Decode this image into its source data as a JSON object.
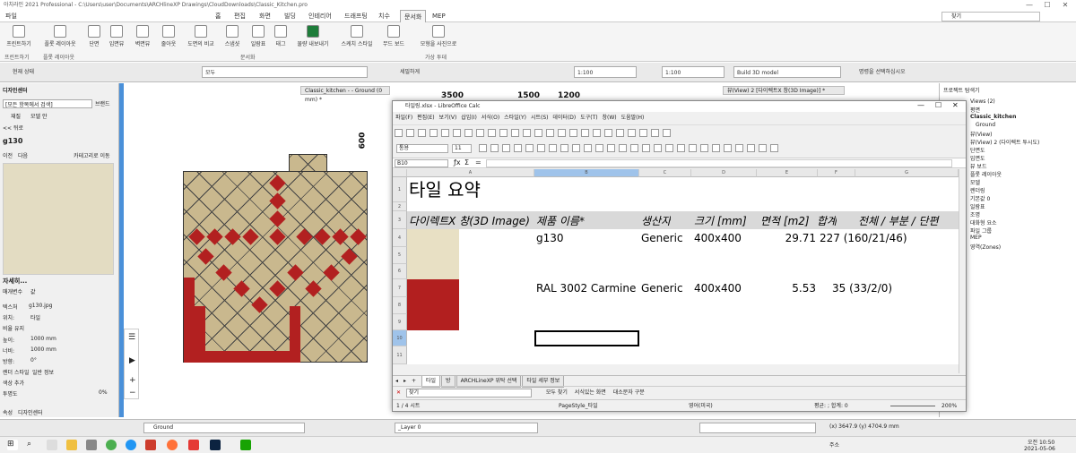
{
  "app": {
    "title": "아치라인 2021  Professional - C:\\Users\\user\\Documents\\ARCHlineXP Drawings\\CloudDownloads\\Classic_Kitchen.pro",
    "minimize": "—",
    "maximize": "☐",
    "close": "✕"
  },
  "menubar": {
    "tabs": [
      "파일",
      "홈",
      "편집",
      "화면",
      "빌딩",
      "인테리어",
      "드래프팅",
      "치수",
      "문서화",
      "MEP"
    ],
    "active_index": 8,
    "search_placeholder": "찾기"
  },
  "ribbon": {
    "buttons": [
      "프린트하기",
      "플롯 레이아웃",
      "단면",
      "입면뷰",
      "벽면뷰",
      "줄아웃",
      "도면의 비교",
      "스냅샷",
      "일람표",
      "태그",
      "물량 내보내기",
      "스케치 스타일",
      "무드 보드",
      "모형을 사진으로"
    ],
    "groups": [
      "프린트하기",
      "플롯 레이아웃",
      "문서화",
      "가상 투데"
    ]
  },
  "propbar": {
    "state": "현재 상태",
    "filter": "모두",
    "scale_label": "세밀하게",
    "scale1": "1:100",
    "scale2": "1:100",
    "model": "Build 3D model",
    "hint": "명령을 선택하십시오"
  },
  "designcenter": {
    "title": "디자인센터",
    "search_placeholder": "[모든 항목에서 검색]",
    "browse": "브랜드",
    "tabs": [
      "재질",
      "모델 안"
    ],
    "back": "<< 뒤로",
    "item": "g130",
    "subtabs": [
      "이전",
      "다음",
      "카테고리로 이동"
    ],
    "details_title": "자세히...",
    "param_col": "매개변수",
    "value_col": "값",
    "texture_label": "텍스처",
    "texture_value": "g130.jpg",
    "location_label": "위치:",
    "location_value": "타일",
    "ratio_label": "비율 유지",
    "height_label": "높이:",
    "height_value": "1000 mm",
    "width_label": "너비:",
    "width_value": "1000 mm",
    "angle_label": "방향:",
    "angle_value": "0°",
    "style_label": "렌더 스타일",
    "style_value": "일반 정보",
    "color_label": "색상 추가",
    "opacity_label": "투명도",
    "opacity_value": "0%",
    "bottom_tabs": [
      "속성",
      "디자인센터"
    ]
  },
  "view_tabs": [
    "Classic_kitchen - - Ground (0 mm) *",
    "뷰(View) 2 [다이렉트X 창(3D Image)] *"
  ],
  "drawing": {
    "dims": [
      "3500",
      "1500",
      "1200",
      "600"
    ]
  },
  "calc": {
    "title": "타일링.xlsx - LibreOffice Calc",
    "menu": [
      "파일(F)",
      "편집(E)",
      "보기(V)",
      "삽입(I)",
      "서식(O)",
      "스타일(Y)",
      "시트(S)",
      "데이터(D)",
      "도구(T)",
      "창(W)",
      "도움말(H)"
    ],
    "font_style": "통용",
    "font_size": "11",
    "cell_ref": "B10",
    "columns": [
      "A",
      "B",
      "C",
      "D",
      "E",
      "F",
      "G"
    ],
    "rows": [
      "1",
      "2",
      "3",
      "4",
      "5",
      "6",
      "7",
      "8",
      "9",
      "10",
      "11"
    ],
    "heading": "타일 요약",
    "header": [
      "다이렉트X 창(3D Image)",
      "제품 이름*",
      "생산자",
      "크기 [mm]",
      "면적 [m2]",
      "합계",
      "전체 / 부분 / 단편"
    ],
    "data": [
      {
        "swatch": "#e8e0c4",
        "name": "g130",
        "maker": "Generic",
        "size": "400x400",
        "area": "29.71",
        "count": "227 (160/21/46)"
      },
      {
        "swatch": "#b21f1f",
        "name": "RAL 3002 Carmine red",
        "maker": "Generic",
        "size": "400x400",
        "area": "5.53",
        "count": "35 (33/2/0)"
      }
    ],
    "sheet_tabs": [
      "타일",
      "방",
      "ARCHLineXP 위탁 선택",
      "타일 세부 정보"
    ],
    "find_placeholder": "찾기",
    "find_all": "모두 찾기",
    "match_format": "서식있는 화면",
    "match_case": "대소문자 구분",
    "status": {
      "sheet": "1 / 4 시트",
      "page_style": "PageStyle_타일",
      "lang": "영어(미국)",
      "sum": "평균: ; 합계: 0",
      "zoom": "200%"
    }
  },
  "navigator": {
    "title": "프로젝트 탐색기",
    "items": [
      "Views (2)",
      "평면",
      "Classic_kitchen",
      "Ground",
      "뷰(View)",
      "뷰(View) 2 (다이렉트 투시도)",
      "단면도",
      "입면도",
      "뷰 보드",
      "플롯 레이아웃",
      "모델",
      "렌더링",
      "기본값 0",
      "일람표",
      "조명",
      "대화형 요소",
      "파일 그룹",
      "MEP",
      "영역(Zones)"
    ]
  },
  "bottombar": {
    "layer": "Ground",
    "sublayer": "_Layer 0",
    "coords": "(x) 3647.9  (y) 4704.9 mm",
    "addr": "주소"
  },
  "taskbar": {
    "time": "오전 10:50",
    "date": "2021-05-06"
  }
}
